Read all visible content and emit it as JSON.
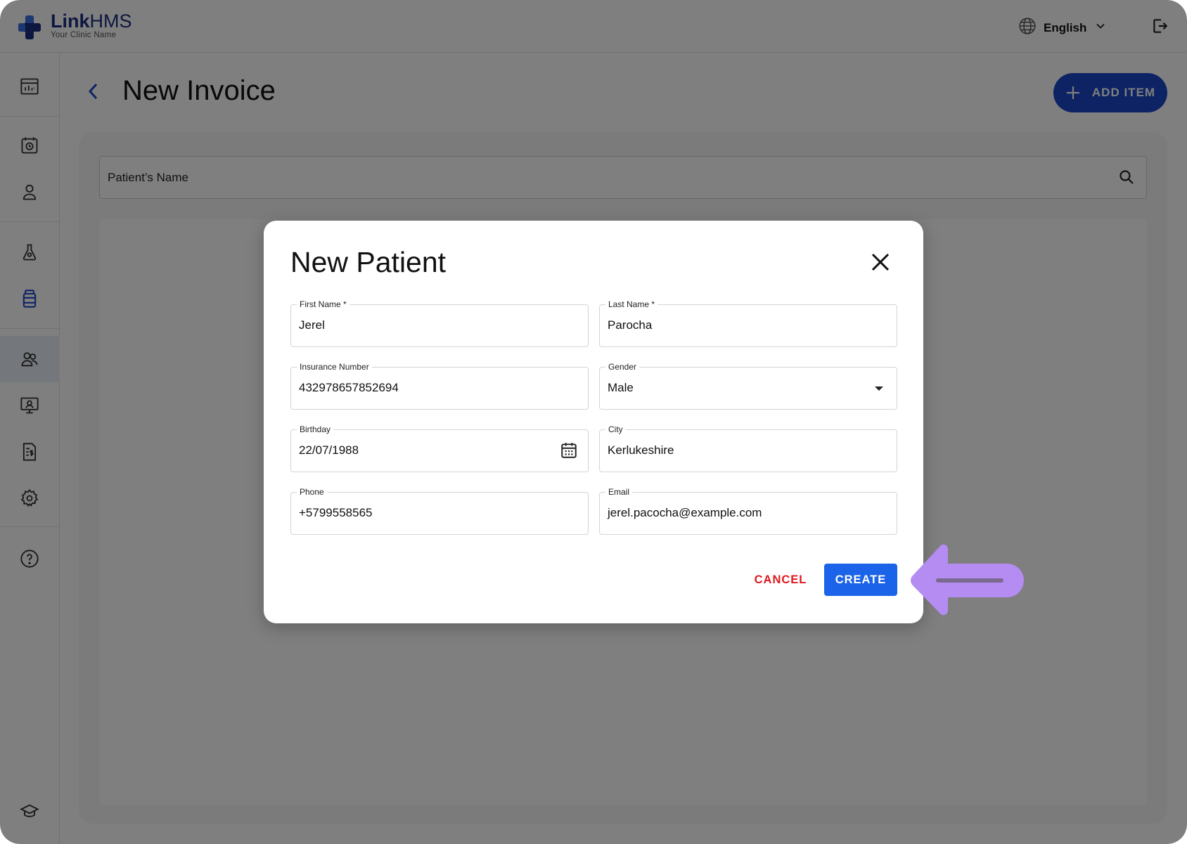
{
  "brand": {
    "name_bold": "Link",
    "name_rest": "HMS",
    "subtitle": "Your Clinic Name"
  },
  "header": {
    "language": "English"
  },
  "page": {
    "title": "New Invoice",
    "add_item_label": "ADD ITEM"
  },
  "search": {
    "placeholder": "Patient’s Name"
  },
  "sidebar": {
    "icons": [
      "dashboard-icon",
      "appointments-icon",
      "patients-icon",
      "lab-icon",
      "pharmacy-icon",
      "staff-icon",
      "telemedicine-icon",
      "invoice-icon",
      "settings-icon",
      "help-icon",
      "education-icon"
    ],
    "active": "pharmacy-icon"
  },
  "dialog": {
    "title": "New Patient",
    "fields": {
      "first_name": {
        "label": "First Name *",
        "value": "Jerel"
      },
      "last_name": {
        "label": "Last Name *",
        "value": "Parocha"
      },
      "insurance": {
        "label": "Insurance Number",
        "value": "432978657852694"
      },
      "gender": {
        "label": "Gender",
        "value": "Male"
      },
      "birthday": {
        "label": "Birthday",
        "value": "22/07/1988"
      },
      "city": {
        "label": "City",
        "value": "Kerlukeshire"
      },
      "phone": {
        "label": "Phone",
        "value": "+5799558565"
      },
      "email": {
        "label": "Email",
        "value": "jerel.pacocha@example.com"
      }
    },
    "cancel_label": "CANCEL",
    "create_label": "CREATE"
  },
  "colors": {
    "brand": "#1c2f80",
    "primary": "#1b63e8",
    "danger": "#e0181f",
    "pointer": "#b48cf2"
  }
}
